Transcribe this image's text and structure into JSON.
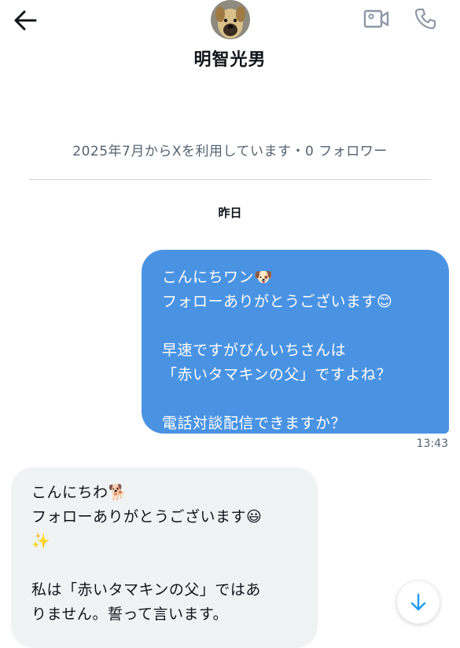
{
  "header": {
    "contact_name": "明智光男"
  },
  "profile_info": "2025年7月からXを利用しています・0 フォロワー",
  "date_separator": "昨日",
  "outgoing_message": {
    "lines": [
      "こんにちワン🐶",
      "フォローありがとうございます😊",
      "",
      "早速ですがびんいちさんは",
      "「赤いタマキンの父」ですよね？",
      "",
      "電話対談配信できますか？"
    ],
    "timestamp": "13:43"
  },
  "incoming_message": {
    "lines": [
      "こんにちわ🐕",
      "フォローありがとうございます😃",
      "✨",
      "",
      "私は「赤いタマキンの父」ではあ",
      "りません。誓って言います。"
    ]
  },
  "colors": {
    "outgoing_bubble": "#4a93e3",
    "incoming_bubble": "#eff3f4",
    "secondary_text": "#536471",
    "scroll_button_arrow": "#1d9bf0"
  },
  "icons": {
    "back": "arrow-left-icon",
    "video": "video-camera-icon",
    "phone": "phone-icon",
    "scroll_down": "arrow-down-icon"
  }
}
